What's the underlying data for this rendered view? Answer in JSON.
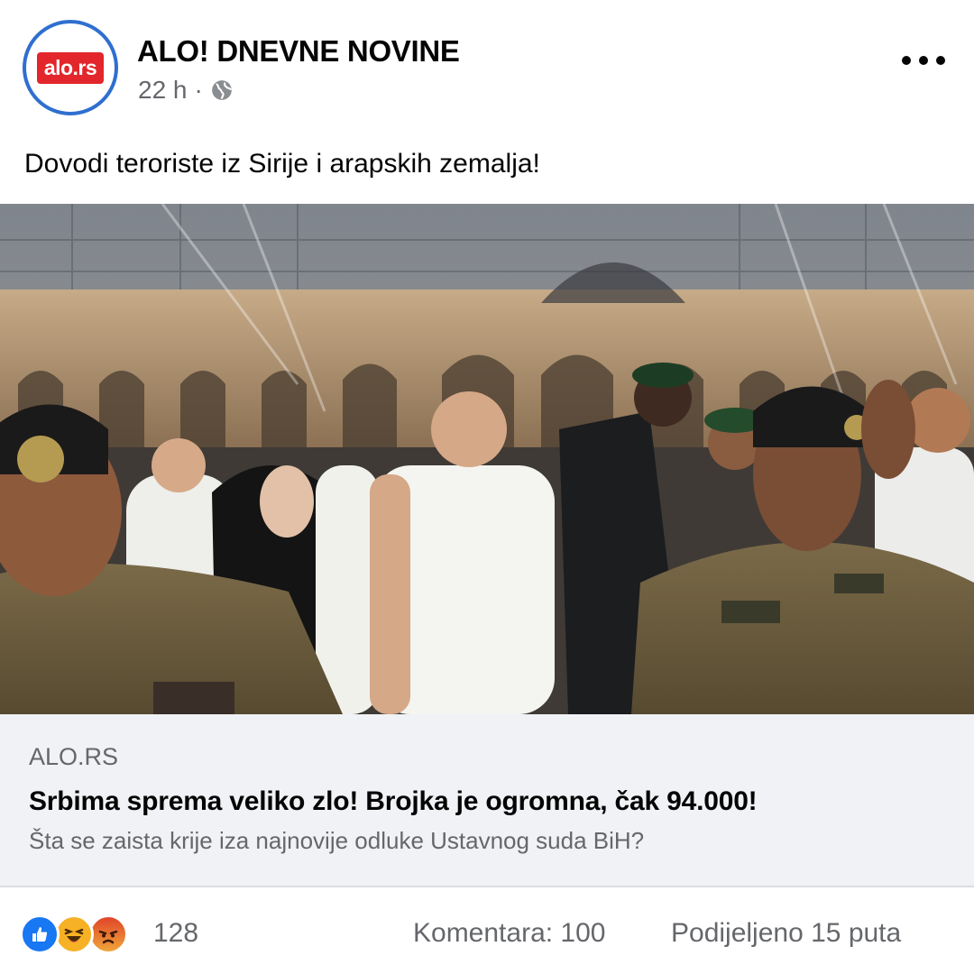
{
  "post": {
    "page_name": "ALO! DNEVNE NOVINE",
    "avatar_text": "alo.rs",
    "time": "22 h",
    "separator": "·",
    "privacy_icon": "globe-icon",
    "more_icon": "more-options-icon",
    "text": "Dovodi teroriste iz Sirije i arapskih zemalja!"
  },
  "link": {
    "domain": "ALO.RS",
    "headline": "Srbima sprema veliko zlo! Brojka je ogromna, čak 94.000!",
    "description": "Šta se zaista krije iza najnovije odluke Ustavnog suda BiH?"
  },
  "engagement": {
    "reaction_icons": [
      "like-icon",
      "haha-icon",
      "angry-icon"
    ],
    "reaction_count": "128",
    "comments": "Komentara: 100",
    "shares": "Podijeljeno 15 puta"
  },
  "colors": {
    "like": "#1877f2",
    "haha": "#f7b125",
    "angry": "#e9710f",
    "avatar_badge": "#e2262b",
    "avatar_ring": "#2f6fcf"
  }
}
